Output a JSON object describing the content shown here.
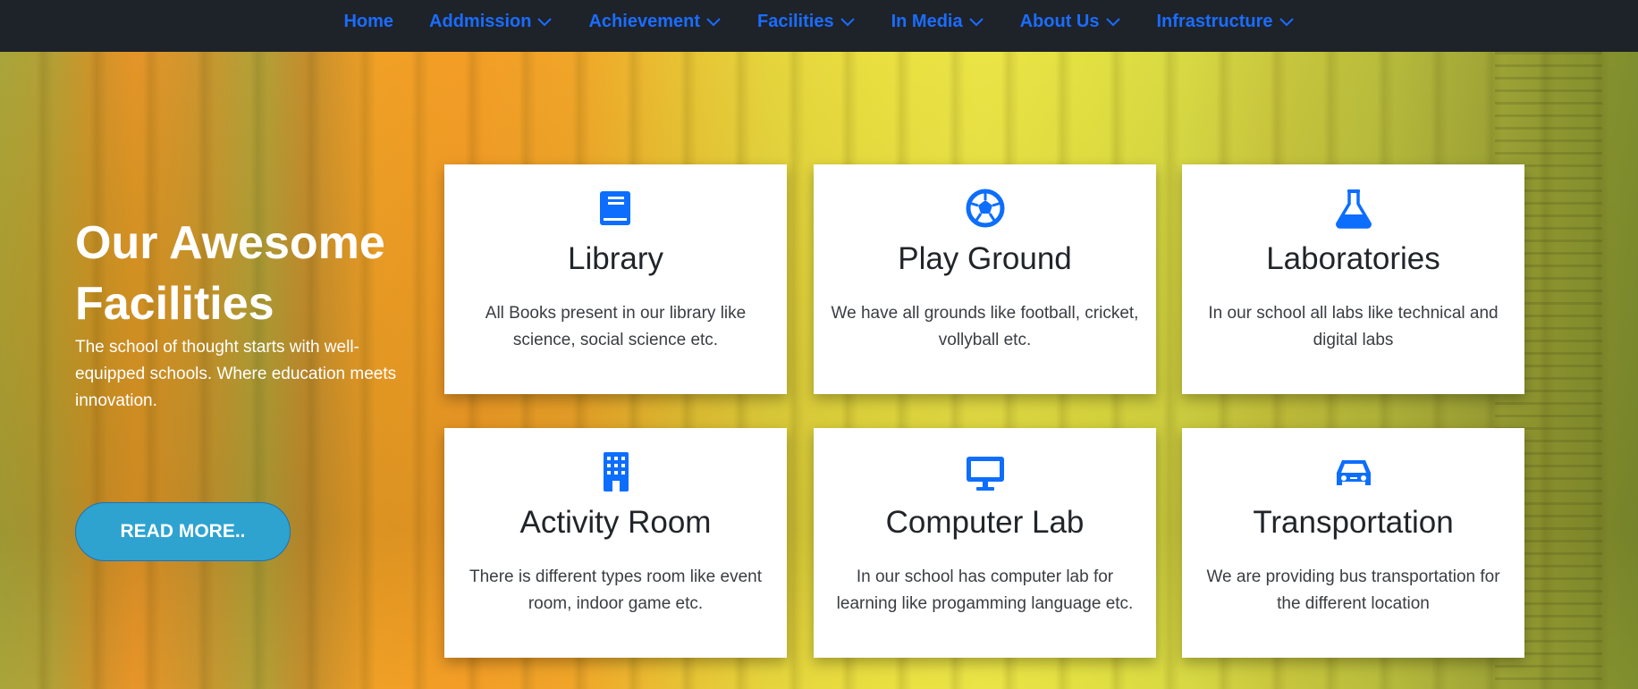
{
  "nav": {
    "items": [
      {
        "label": "Home",
        "has_dropdown": false
      },
      {
        "label": "Addmission",
        "has_dropdown": true
      },
      {
        "label": "Achievement",
        "has_dropdown": true
      },
      {
        "label": "Facilities",
        "has_dropdown": true
      },
      {
        "label": "In Media",
        "has_dropdown": true
      },
      {
        "label": "About Us",
        "has_dropdown": true
      },
      {
        "label": "Infrastructure",
        "has_dropdown": true
      }
    ]
  },
  "hero": {
    "title": "Our Awesome Facilities",
    "description": "The school of thought starts with well-equipped schools. Where education meets innovation.",
    "button_label": "READ MORE.."
  },
  "facilities": [
    {
      "icon": "book-icon",
      "title": "Library",
      "text": "All Books present in our library like science, social science etc."
    },
    {
      "icon": "football-icon",
      "title": "Play Ground",
      "text": "We have all grounds like football, cricket, vollyball etc."
    },
    {
      "icon": "flask-icon",
      "title": "Laboratories",
      "text": "In our school all labs like technical and digital labs"
    },
    {
      "icon": "building-icon",
      "title": "Activity Room",
      "text": "There is different types room like event room, indoor game etc."
    },
    {
      "icon": "monitor-icon",
      "title": "Computer Lab",
      "text": "In our school has computer lab for learning like progamming language etc."
    },
    {
      "icon": "car-icon",
      "title": "Transportation",
      "text": "We are providing bus transportation for the different location"
    }
  ],
  "colors": {
    "nav_bg": "#1e2229",
    "nav_link": "#1a6dff",
    "icon_blue": "#0d6efd",
    "button_bg": "#2ea3d0"
  }
}
